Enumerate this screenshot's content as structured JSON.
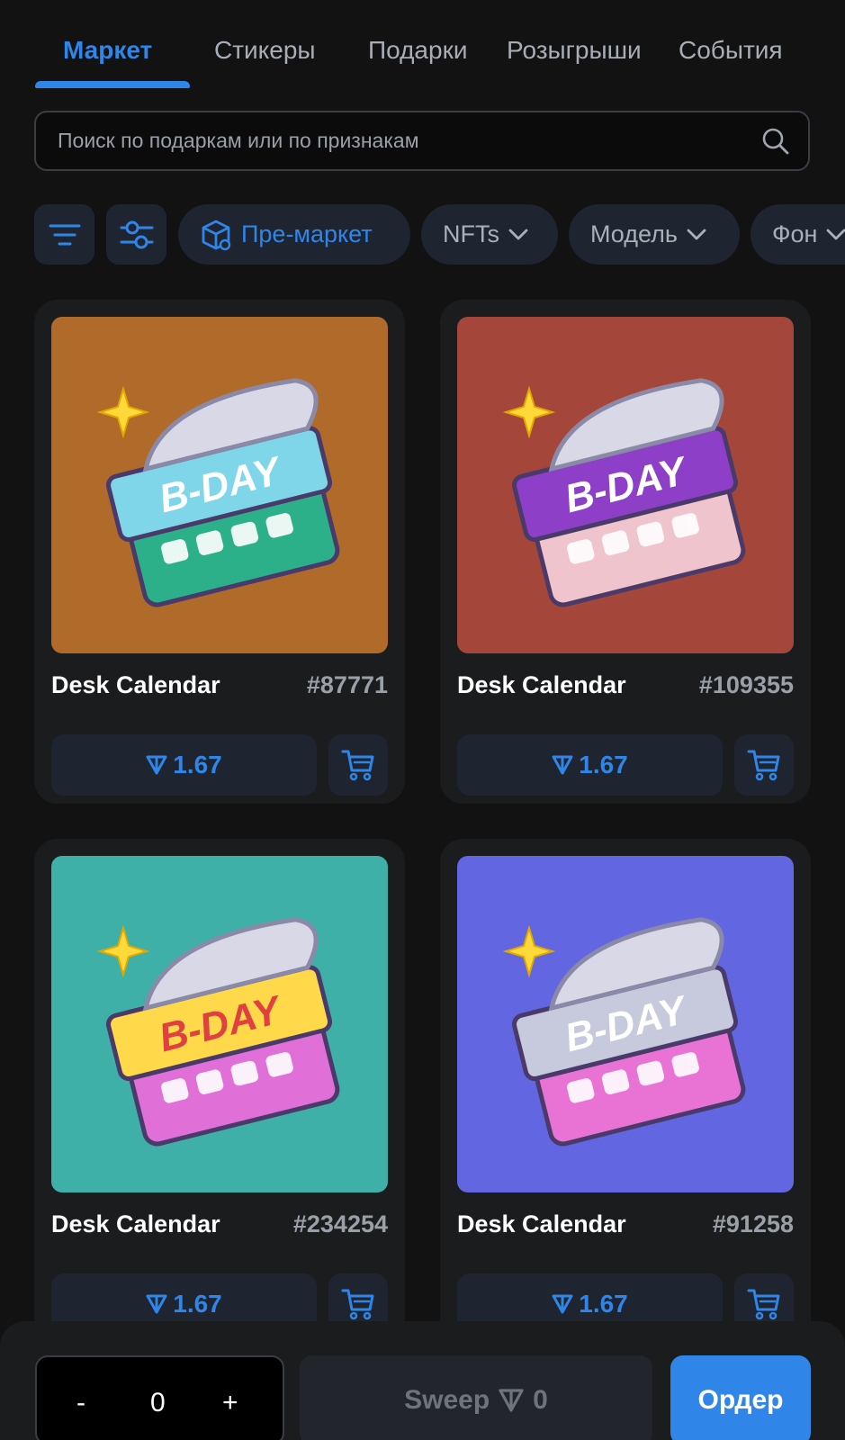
{
  "tabs": [
    {
      "label": "Маркет",
      "active": true
    },
    {
      "label": "Стикеры"
    },
    {
      "label": "Подарки"
    },
    {
      "label": "Розыгрыши"
    },
    {
      "label": "События"
    }
  ],
  "search": {
    "placeholder": "Поиск по подаркам или по признакам"
  },
  "filters": {
    "premarket_label": "Пре-маркет",
    "nfts_label": "NFTs",
    "model_label": "Модель",
    "background_label": "Фон"
  },
  "cards": [
    {
      "name": "Desk Calendar",
      "number": "#87771",
      "price": "1.67",
      "bg": "#b06a2a",
      "page": "#7fd6e8",
      "body": "#2bb08a",
      "text_color": "#ffffff"
    },
    {
      "name": "Desk Calendar",
      "number": "#109355",
      "price": "1.67",
      "bg": "#a4473a",
      "page": "#8e3fc7",
      "body": "#f0c4cc",
      "text_color": "#ffffff"
    },
    {
      "name": "Desk Calendar",
      "number": "#234254",
      "price": "1.67",
      "bg": "#3fb0a8",
      "page": "#ffd94a",
      "body": "#e070d8",
      "text_color": "#e04040"
    },
    {
      "name": "Desk Calendar",
      "number": "#91258",
      "price": "1.67",
      "bg": "#6266e0",
      "page": "#c7c9dc",
      "body": "#e873d4",
      "text_color": "#ffffff"
    }
  ],
  "card_image_text": "B-DAY",
  "bottom": {
    "minus": "-",
    "quantity": "0",
    "plus": "+",
    "sweep_label": "Sweep",
    "sweep_value": "0",
    "order_label": "Ордер"
  },
  "colors": {
    "accent": "#2f86e8",
    "background": "#121212",
    "card": "#1b1c1e"
  }
}
